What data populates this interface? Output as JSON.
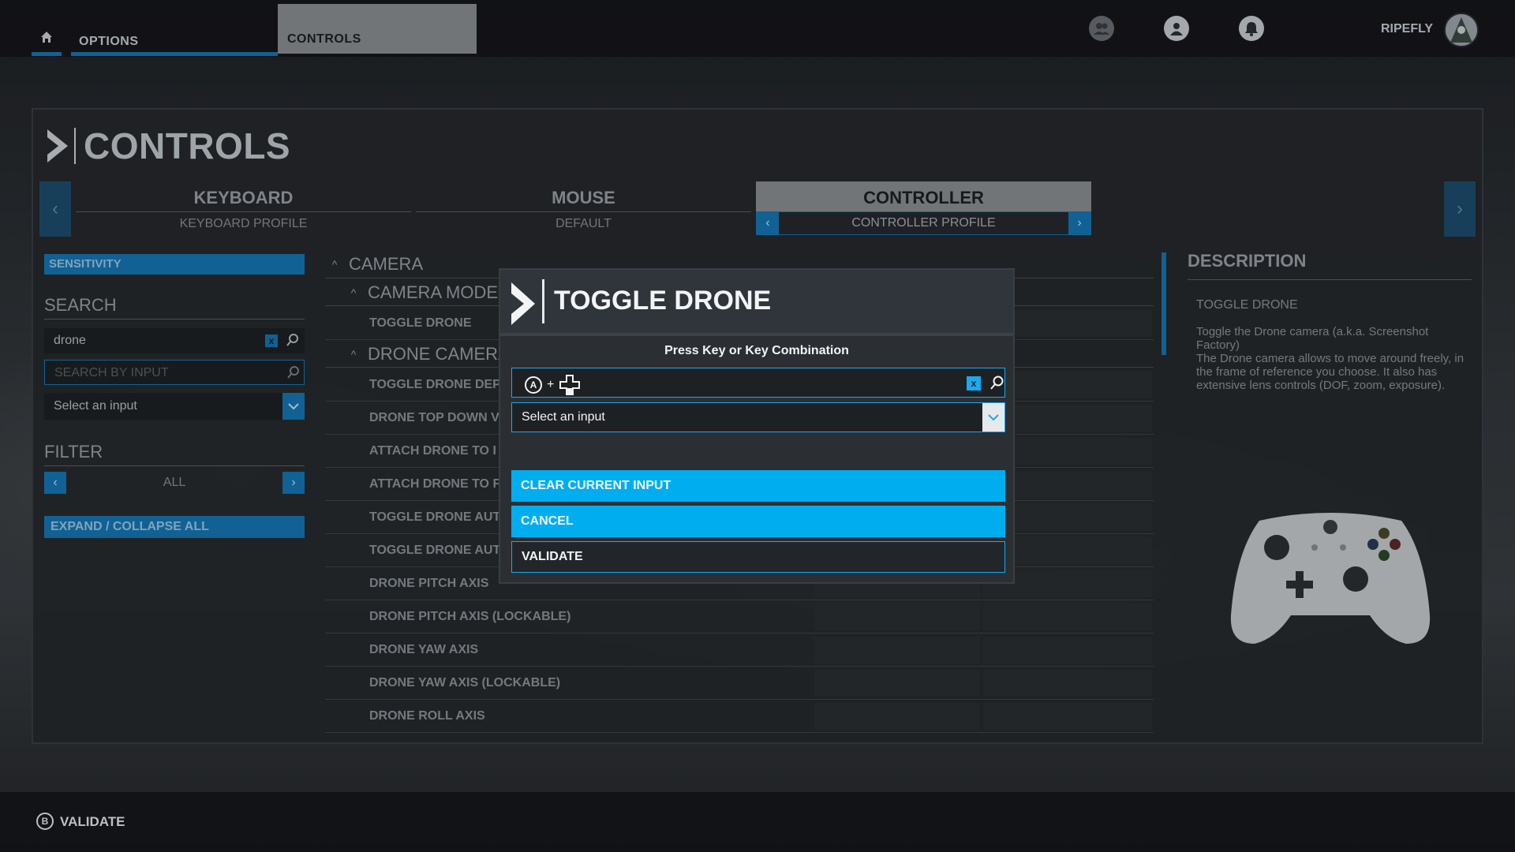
{
  "topbar": {
    "tabs": [
      {
        "label": "OPTIONS"
      },
      {
        "label": "CONTROLS"
      }
    ],
    "username": "RIPEFLY",
    "icons": [
      "friends-icon",
      "profile-icon",
      "notifications-icon"
    ]
  },
  "panel": {
    "title": "CONTROLS",
    "devices": [
      {
        "name": "KEYBOARD",
        "profile": "KEYBOARD PROFILE"
      },
      {
        "name": "MOUSE",
        "profile": "DEFAULT"
      },
      {
        "name": "CONTROLLER",
        "profile": "CONTROLLER PROFILE",
        "selected": true
      }
    ]
  },
  "left": {
    "sensitivity": "SENSITIVITY",
    "search_heading": "SEARCH",
    "search_value": "drone",
    "search_by_input_placeholder": "SEARCH BY INPUT",
    "select_input": "Select an input",
    "filter_heading": "FILTER",
    "filter_value": "ALL",
    "expand_collapse": "EXPAND / COLLAPSE ALL"
  },
  "list": {
    "category": "CAMERA",
    "subcategories": [
      "CAMERA MODE",
      "DRONE CAMERA"
    ],
    "items_under_camera_mode": [
      "TOGGLE DRONE"
    ],
    "items_under_drone_camera": [
      "TOGGLE DRONE DEP",
      "DRONE TOP DOWN V",
      "ATTACH DRONE TO I",
      "ATTACH DRONE TO F",
      "TOGGLE DRONE AUT",
      "TOGGLE DRONE AUT",
      "DRONE PITCH AXIS",
      "DRONE PITCH AXIS (LOCKABLE)",
      "DRONE YAW AXIS",
      "DRONE YAW AXIS (LOCKABLE)",
      "DRONE ROLL AXIS"
    ]
  },
  "description": {
    "heading": "DESCRIPTION",
    "item": "TOGGLE DRONE",
    "text": "Toggle the Drone camera (a.k.a. Screenshot Factory)\nThe Drone camera allows to move around freely, in the frame of reference you choose. It also has extensive lens controls (DOF, zoom, exposure)."
  },
  "dialog": {
    "title": "TOGGLE DRONE",
    "prompt": "Press Key or Key Combination",
    "combo_button": "A",
    "combo_plus": "+",
    "select_input": "Select an input",
    "buttons": {
      "clear": "CLEAR CURRENT INPUT",
      "cancel": "CANCEL",
      "validate": "VALIDATE"
    }
  },
  "bottombar": {
    "button_glyph": "B",
    "label": "VALIDATE"
  },
  "colors": {
    "accent": "#1577b5",
    "dialog_accent": "#00aef0"
  }
}
